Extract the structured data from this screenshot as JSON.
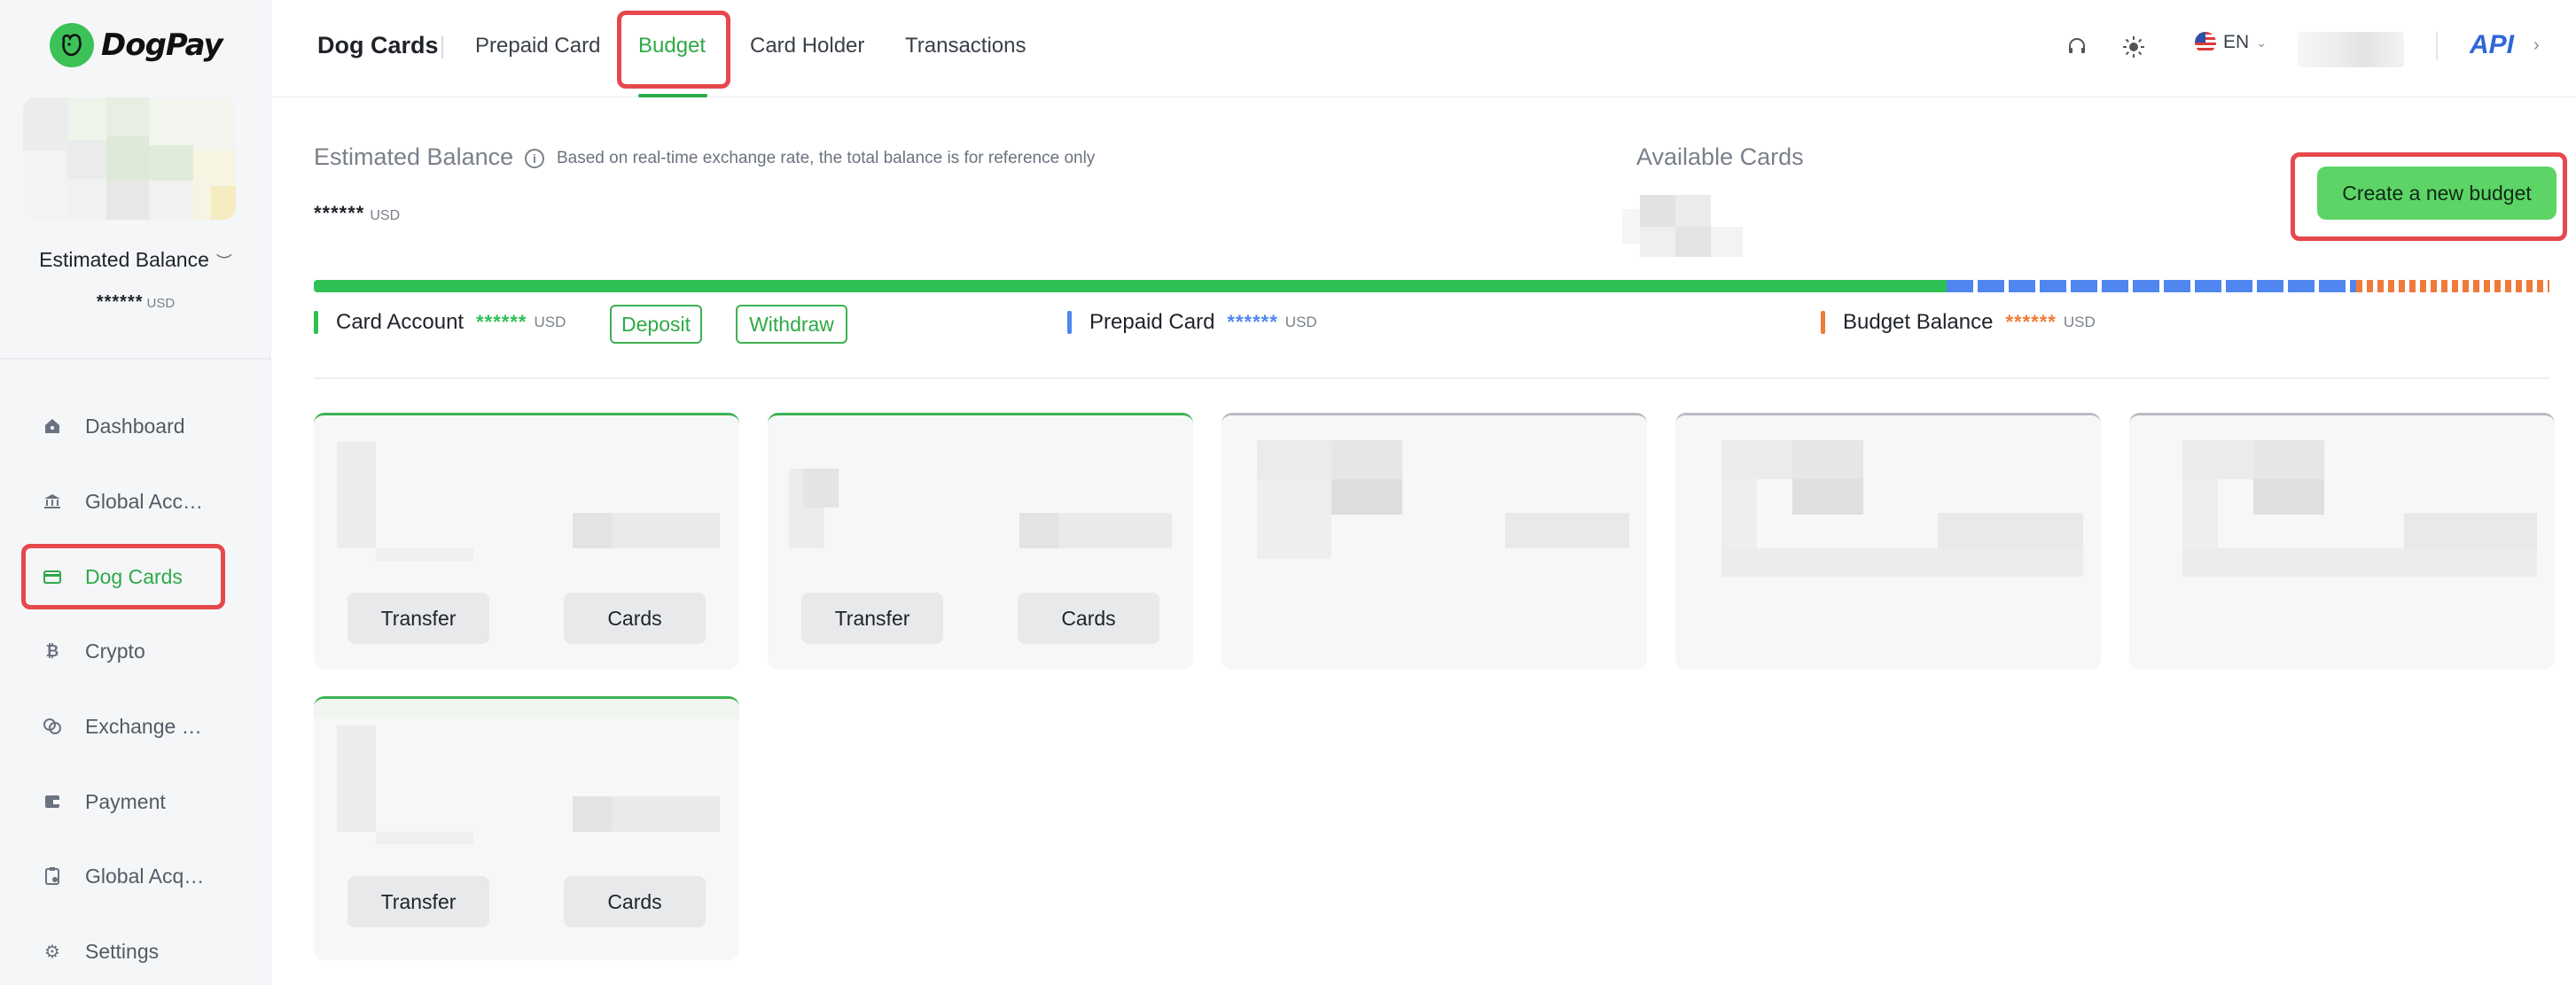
{
  "brand": {
    "name": "DogPay"
  },
  "sidebar": {
    "balance_label": "Estimated Balance",
    "balance_value": "******",
    "balance_unit": "USD",
    "items": [
      {
        "label": "Dashboard",
        "icon": "home-icon"
      },
      {
        "label": "Global Accounts",
        "icon": "bank-icon"
      },
      {
        "label": "Dog Cards",
        "icon": "card-icon",
        "active": true
      },
      {
        "label": "Crypto",
        "icon": "bitcoin-icon"
      },
      {
        "label": "Exchange Currency",
        "icon": "exchange-icon"
      },
      {
        "label": "Payment",
        "icon": "wallet-icon"
      },
      {
        "label": "Global Acquiring",
        "icon": "acquiring-icon"
      },
      {
        "label": "Settings",
        "icon": "gear-icon"
      }
    ]
  },
  "header": {
    "title": "Dog Cards",
    "tabs": [
      {
        "label": "Prepaid Card"
      },
      {
        "label": "Budget",
        "active": true
      },
      {
        "label": "Card Holder"
      },
      {
        "label": "Transactions"
      }
    ],
    "language": "EN",
    "api_label": "API",
    "api_arrow": "›"
  },
  "summary": {
    "estimated_label": "Estimated Balance",
    "info_icon": "i",
    "estimated_hint": "Based on real-time exchange rate, the total balance is for reference only",
    "estimated_value": "******",
    "estimated_unit": "USD",
    "available_label": "Available Cards",
    "create_button": "Create a new budget"
  },
  "bar_colors": {
    "card_account": "#2ec055",
    "prepaid_card": "#4f86f0",
    "budget_balance": "#f07a3a"
  },
  "legend": {
    "card_account": {
      "label": "Card Account",
      "value": "******",
      "unit": "USD"
    },
    "deposit_button": "Deposit",
    "withdraw_button": "Withdraw",
    "prepaid_card": {
      "label": "Prepaid Card",
      "value": "******",
      "unit": "USD"
    },
    "budget_balance": {
      "label": "Budget Balance",
      "value": "******",
      "unit": "USD"
    }
  },
  "budget_cards": {
    "transfer_label": "Transfer",
    "cards_label": "Cards"
  }
}
